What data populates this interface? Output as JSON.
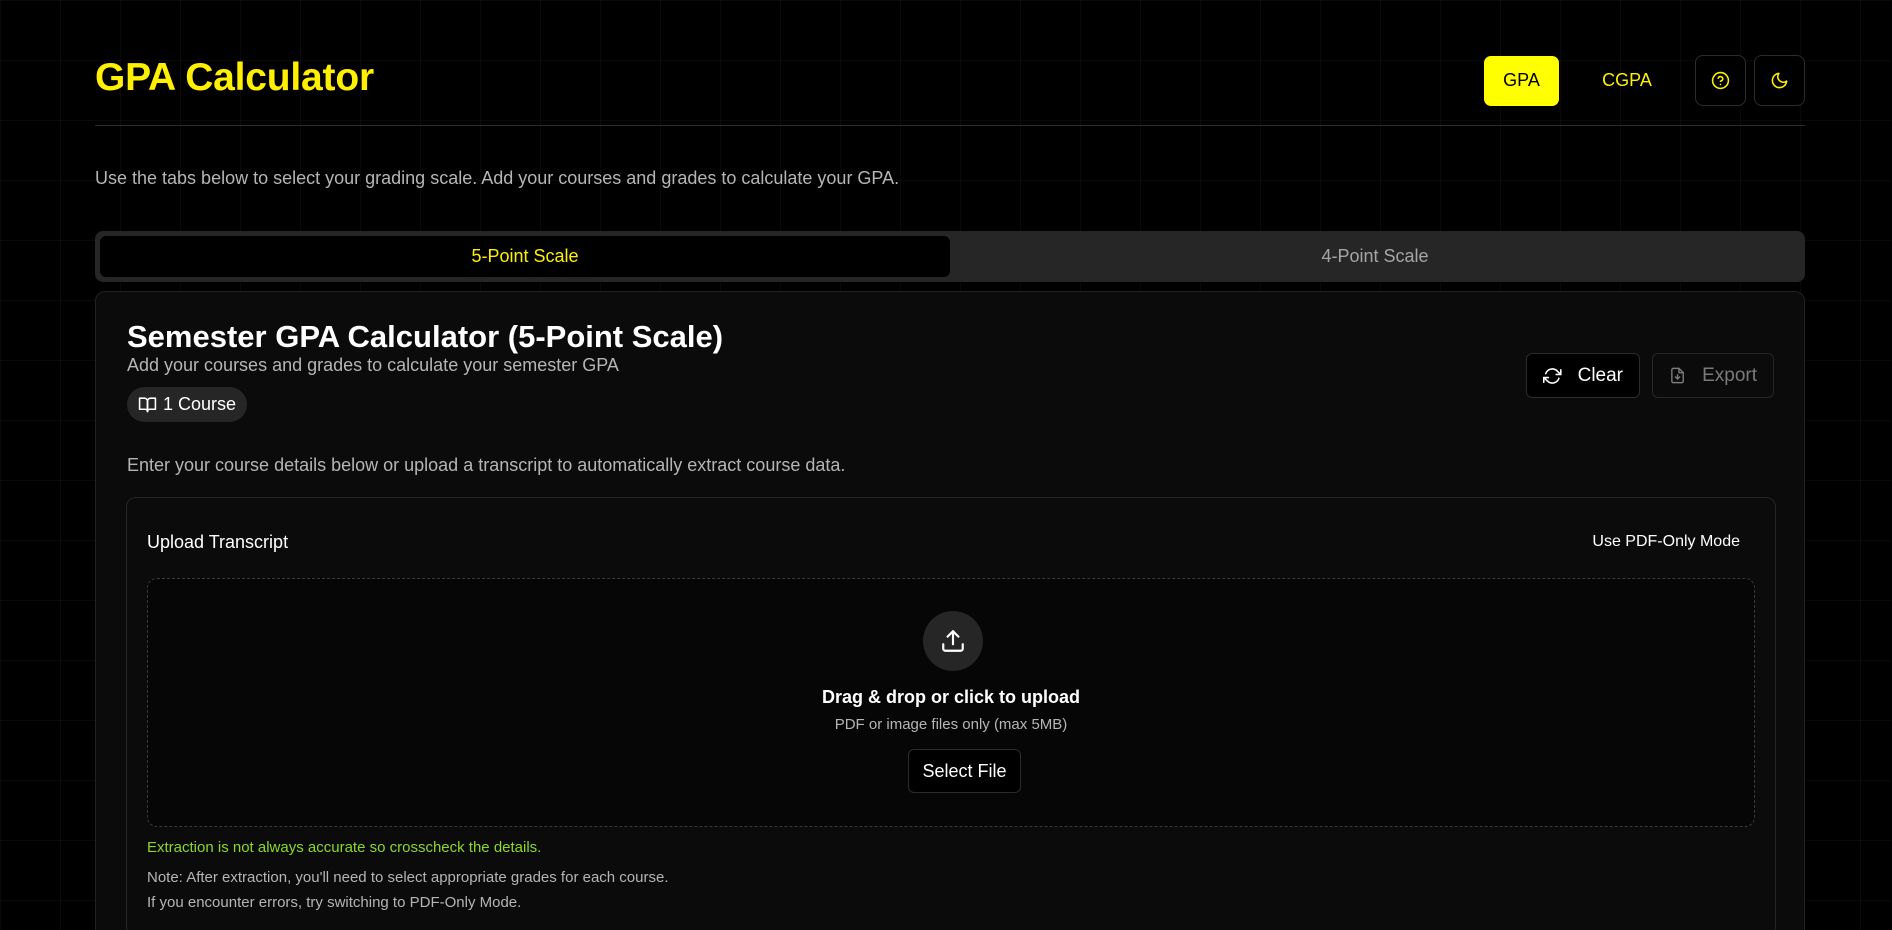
{
  "header": {
    "title": "GPA Calculator",
    "gpa_label": "GPA",
    "cgpa_label": "CGPA",
    "help_icon": "help-circle-icon",
    "theme_icon": "moon-icon"
  },
  "intro": "Use the tabs below to select your grading scale. Add your courses and grades to calculate your GPA.",
  "tabs": [
    {
      "label": "5-Point Scale",
      "active": true
    },
    {
      "label": "4-Point Scale",
      "active": false
    }
  ],
  "card": {
    "title": "Semester GPA Calculator (5-Point Scale)",
    "subtitle": "Add your courses and grades to calculate your semester GPA",
    "badge": "1 Course",
    "clear_label": "Clear",
    "export_label": "Export",
    "description": "Enter your course details below or upload a transcript to automatically extract course data."
  },
  "upload": {
    "title": "Upload Transcript",
    "mode_toggle": "Use PDF-Only Mode",
    "drop_title": "Drag & drop or click to upload",
    "drop_sub": "PDF or image files only (max 5MB)",
    "select_label": "Select File",
    "warning": "Extraction is not always accurate so crosscheck the details.",
    "note1": "Note: After extraction, you'll need to select appropriate grades for each course.",
    "note2": "If you encounter errors, try switching to PDF-Only Mode."
  },
  "colors": {
    "accent": "#ffef00",
    "background": "#000000",
    "card": "#0b0b0b",
    "warning": "#8bd829"
  }
}
